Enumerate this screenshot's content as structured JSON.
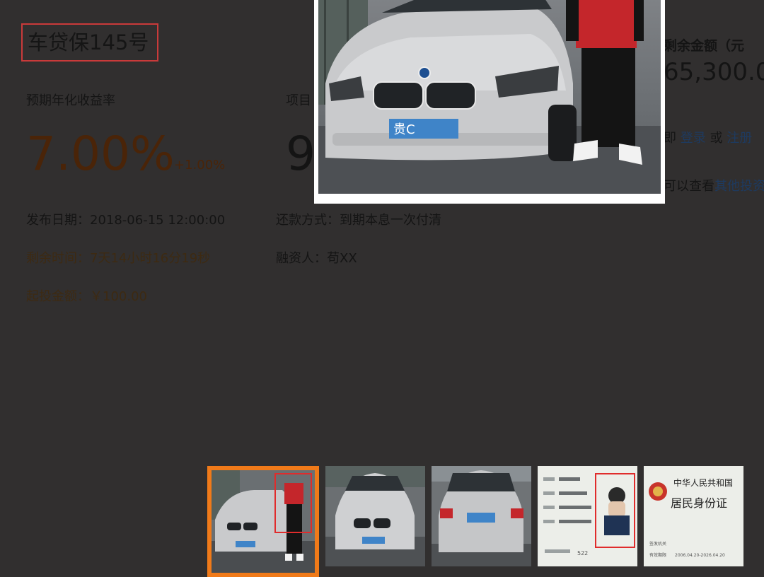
{
  "loan": {
    "title": "车贷保145号",
    "rate_label": "预期年化收益率",
    "rate_value": "7.00%",
    "rate_bonus": "+1.00%",
    "project_label_partial": "项目",
    "project_value_partial": "9",
    "publish_date": "发布日期：2018-06-15 12:00:00",
    "repay_method": "还款方式：到期本息一次付清",
    "time_left": "剩余时间：7天14小时16分19秒",
    "borrower": "融资人：苟XX",
    "min_invest": "起投金额：￥100.00"
  },
  "sidebar": {
    "remaining_label": "剩余金额（元",
    "remaining_amount": "65,300.00",
    "login_prefix": "即",
    "login_link": "登录",
    "or_text": "或",
    "register_link": "注册",
    "view_prefix": "可以查看",
    "view_link": "其他投资"
  },
  "photo": {
    "plate_text": "贵C"
  },
  "thumbnails": [
    {
      "name": "car-with-person",
      "plate": "贵C",
      "selected": true
    },
    {
      "name": "car-front",
      "plate": "贵C",
      "selected": false
    },
    {
      "name": "car-rear",
      "plate": "贵C",
      "selected": false
    },
    {
      "name": "id-card-front",
      "selected": false
    },
    {
      "name": "id-card-back",
      "selected": false
    }
  ],
  "id_card": {
    "country": "中华人民共和国",
    "card_name": "居民身份证",
    "validity_label": "有效期限",
    "validity_value": "2006.04.20-2026.04.20",
    "issuer_label": "签发机关",
    "id_prefix": "522"
  },
  "colors": {
    "overlay_bg": "#312f2f",
    "selected_border": "#f07a19",
    "highlight_red": "#e02c2c",
    "rate_brown": "#4a2408"
  }
}
